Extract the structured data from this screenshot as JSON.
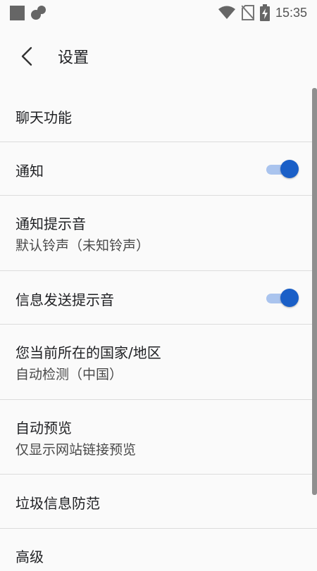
{
  "status_bar": {
    "time": "15:35",
    "icons": [
      "notification-square-icon",
      "cloud-icon",
      "wifi-icon",
      "no-sim-icon",
      "battery-charging-icon"
    ]
  },
  "toolbar": {
    "back_icon": "chevron-left-icon",
    "title": "设置"
  },
  "settings": [
    {
      "title": "聊天功能"
    },
    {
      "title": "通知",
      "toggle": true
    },
    {
      "title": "通知提示音",
      "subtitle": "默认铃声（未知铃声）"
    },
    {
      "title": "信息发送提示音",
      "toggle": true
    },
    {
      "title": "您当前所在的国家/地区",
      "subtitle": "自动检测（中国）"
    },
    {
      "title": "自动预览",
      "subtitle": "仅显示网站链接预览"
    },
    {
      "title": "垃圾信息防范"
    },
    {
      "title": "高级"
    }
  ],
  "colors": {
    "accent": "#1a5fc7",
    "toggle_track": "#aac4ee",
    "background": "#fafafa",
    "divider": "#dcdcdc"
  }
}
